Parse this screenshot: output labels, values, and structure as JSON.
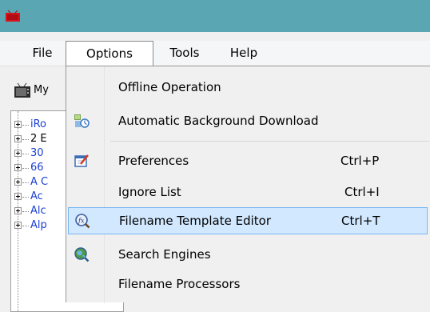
{
  "menubar": {
    "items": [
      "File",
      "Options",
      "Tools",
      "Help"
    ]
  },
  "toolbar": {
    "label": "My"
  },
  "tree": {
    "items": [
      "iRo",
      "2 E",
      "30",
      "66",
      "A C",
      "Ac",
      "Alc",
      "Alp"
    ]
  },
  "dropdown": {
    "items": [
      {
        "label": "Offline Operation",
        "shortcut": "",
        "icon": "none"
      },
      {
        "label": "Automatic Background Download",
        "shortcut": "",
        "icon": "background-download-icon"
      },
      {
        "label": "Preferences",
        "shortcut": "Ctrl+P",
        "icon": "preferences-icon"
      },
      {
        "label": "Ignore List",
        "shortcut": "Ctrl+I",
        "icon": "none"
      },
      {
        "label": "Filename Template Editor",
        "shortcut": "Ctrl+T",
        "icon": "function-magnifier-icon"
      },
      {
        "label": "Search Engines",
        "shortcut": "",
        "icon": "globe-magnifier-icon"
      },
      {
        "label": "Filename Processors",
        "shortcut": "",
        "icon": "none"
      }
    ],
    "highlighted_label": "Filename Template Editor"
  },
  "colors": {
    "titlebar": "#5aa6b3",
    "highlight_bg": "#d1e8ff",
    "highlight_border": "#78b6f0",
    "tree_text": "#1a3fd4"
  }
}
